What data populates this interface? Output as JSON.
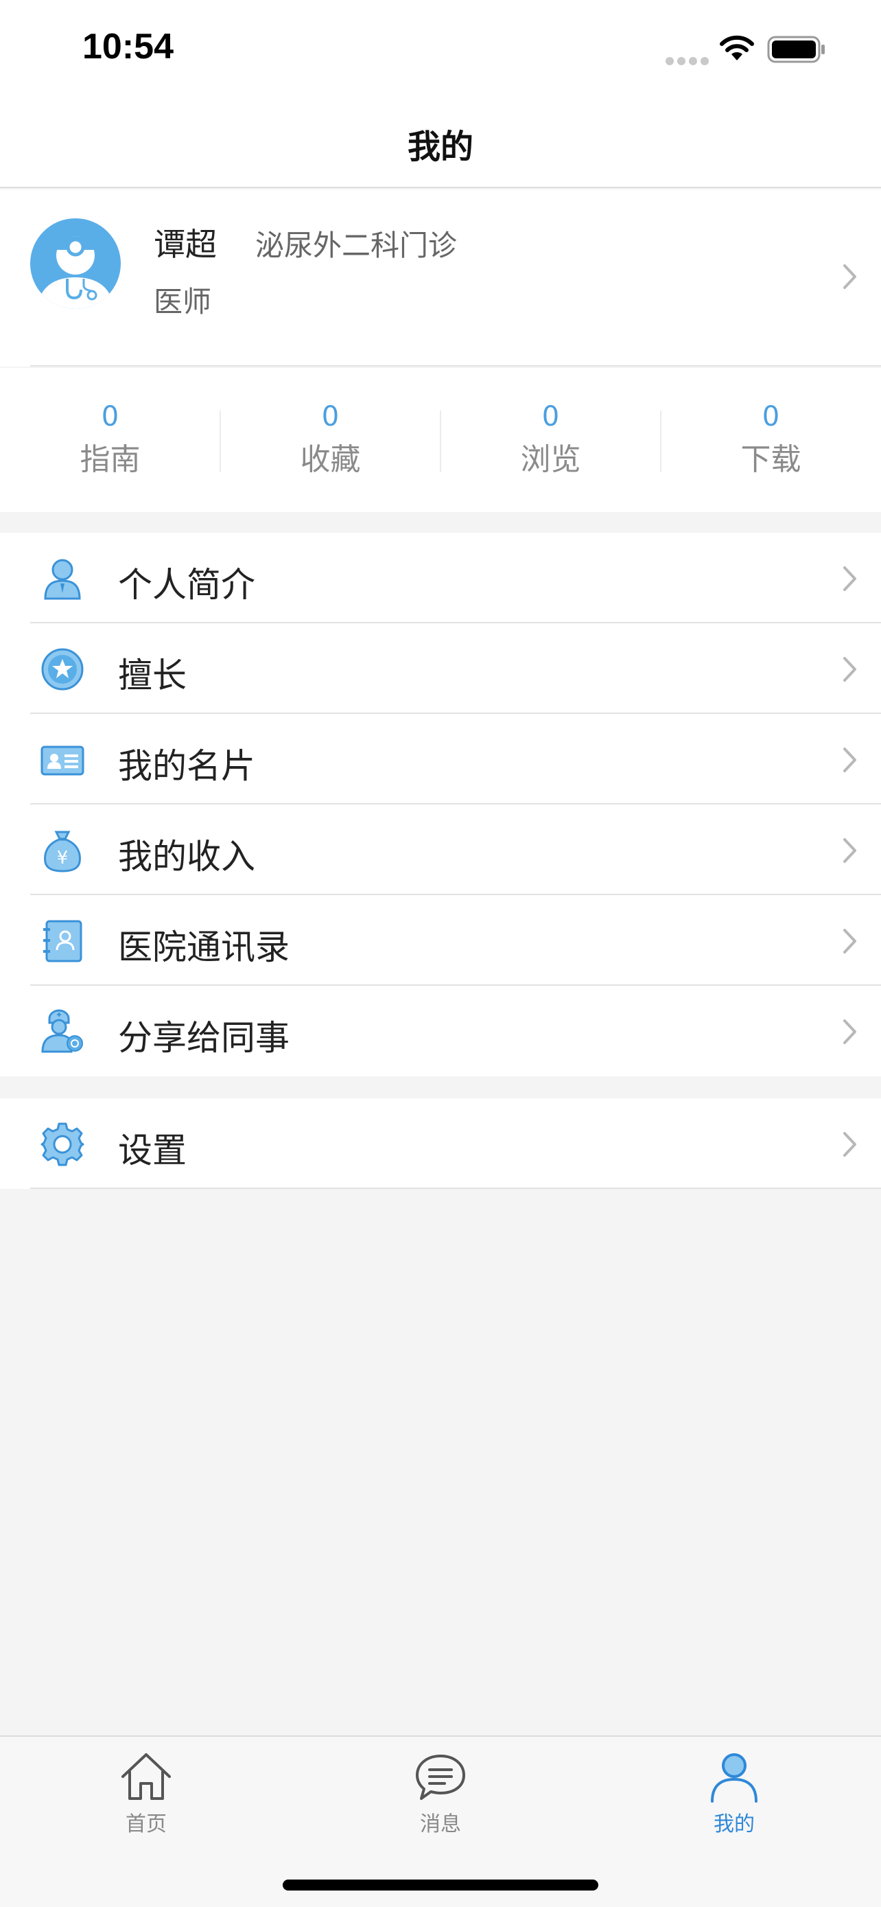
{
  "status_bar": {
    "time": "10:54"
  },
  "nav": {
    "title": "我的"
  },
  "profile": {
    "name": "谭超",
    "department": "泌尿外二科门诊",
    "title": "医师",
    "avatar_icon": "doctor-avatar-icon"
  },
  "stats": [
    {
      "count": "0",
      "label": "指南"
    },
    {
      "count": "0",
      "label": "收藏"
    },
    {
      "count": "0",
      "label": "浏览"
    },
    {
      "count": "0",
      "label": "下载"
    }
  ],
  "menu_group_1": [
    {
      "label": "个人简介",
      "icon": "person-icon"
    },
    {
      "label": "擅长",
      "icon": "star-badge-icon"
    },
    {
      "label": "我的名片",
      "icon": "id-card-icon"
    },
    {
      "label": "我的收入",
      "icon": "money-bag-icon"
    },
    {
      "label": "医院通讯录",
      "icon": "contacts-book-icon"
    },
    {
      "label": "分享给同事",
      "icon": "share-doctor-icon"
    }
  ],
  "menu_group_2": [
    {
      "label": "设置",
      "icon": "gear-icon"
    }
  ],
  "tab_bar": {
    "tabs": [
      {
        "label": "首页",
        "icon": "home-icon",
        "active": false
      },
      {
        "label": "消息",
        "icon": "message-icon",
        "active": false
      },
      {
        "label": "我的",
        "icon": "profile-icon",
        "active": true
      }
    ]
  },
  "colors": {
    "accent": "#2f88d8",
    "icon_blue": "#5aaee8",
    "count_blue": "#4a9fe0",
    "background": "#f4f4f4"
  }
}
